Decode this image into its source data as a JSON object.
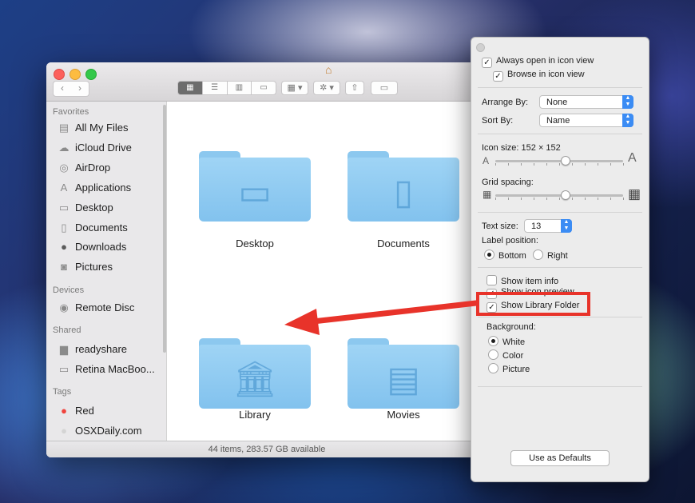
{
  "finder": {
    "sidebar": {
      "favorites_header": "Favorites",
      "favorites": [
        {
          "label": "All My Files",
          "icon": "all-files-icon"
        },
        {
          "label": "iCloud Drive",
          "icon": "cloud-icon"
        },
        {
          "label": "AirDrop",
          "icon": "airdrop-icon"
        },
        {
          "label": "Applications",
          "icon": "applications-icon"
        },
        {
          "label": "Desktop",
          "icon": "desktop-icon"
        },
        {
          "label": "Documents",
          "icon": "documents-icon"
        },
        {
          "label": "Downloads",
          "icon": "downloads-icon"
        },
        {
          "label": "Pictures",
          "icon": "pictures-icon"
        }
      ],
      "devices_header": "Devices",
      "devices": [
        {
          "label": "Remote Disc",
          "icon": "disc-icon"
        }
      ],
      "shared_header": "Shared",
      "shared": [
        {
          "label": "readyshare",
          "icon": "monitor-icon"
        },
        {
          "label": "Retina MacBoo...",
          "icon": "laptop-icon"
        }
      ],
      "tags_header": "Tags",
      "tags": [
        {
          "label": "Red",
          "color": "#f0443e"
        },
        {
          "label": "OSXDaily.com",
          "color": "#d4d4d4"
        }
      ]
    },
    "folders": [
      {
        "label": "Desktop",
        "icon": "desktop-folder-icon"
      },
      {
        "label": "Documents",
        "icon": "documents-folder-icon"
      },
      {
        "label": "Library",
        "icon": "library-folder-icon"
      },
      {
        "label": "Movies",
        "icon": "movies-folder-icon"
      }
    ],
    "status": "44 items, 283.57 GB available"
  },
  "view_options": {
    "always_open": "Always open in icon view",
    "browse": "Browse in icon view",
    "arrange_by_label": "Arrange By:",
    "arrange_by_value": "None",
    "sort_by_label": "Sort By:",
    "sort_by_value": "Name",
    "icon_size_label": "Icon size:",
    "icon_size_value": "152 × 152",
    "icon_size_level": 0.55,
    "grid_spacing_label": "Grid spacing:",
    "grid_spacing_level": 0.55,
    "text_size_label": "Text size:",
    "text_size_value": "13",
    "label_position_label": "Label position:",
    "label_bottom": "Bottom",
    "label_right": "Right",
    "show_item_info": "Show item info",
    "show_icon_preview": "Show icon preview",
    "show_library": "Show Library Folder",
    "background_label": "Background:",
    "bg_white": "White",
    "bg_color": "Color",
    "bg_picture": "Picture",
    "defaults_button": "Use as Defaults"
  },
  "colors": {
    "annotation_red": "#e8332a",
    "popup_blue": "#3b8cf4",
    "folder_blue": "#8cc8ef"
  }
}
